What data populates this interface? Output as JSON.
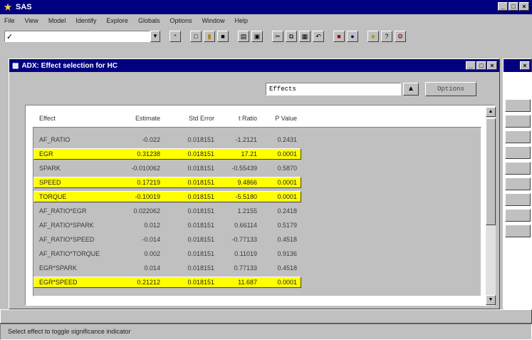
{
  "app": {
    "title": "SAS"
  },
  "menu": [
    "File",
    "View",
    "Model",
    "Identify",
    "Explore",
    "Globals",
    "Options",
    "Window",
    "Help"
  ],
  "window": {
    "title": "ADX: Effect selection for HC",
    "selector_value": "Effects",
    "options_label": "Options"
  },
  "table": {
    "headers": [
      "Effect",
      "Estimate",
      "Std Error",
      "t Ratio",
      "P Value"
    ],
    "rows": [
      {
        "effect": "AF_RATIO",
        "estimate": "-0.022",
        "std_error": "0.018151",
        "t_ratio": "-1.2121",
        "p_value": "0.2431",
        "highlighted": false
      },
      {
        "effect": "EGR",
        "estimate": "0.31238",
        "std_error": "0.018151",
        "t_ratio": "17.21",
        "p_value": "0.0001",
        "highlighted": true
      },
      {
        "effect": "SPARK",
        "estimate": "-0.010062",
        "std_error": "0.018151",
        "t_ratio": "-0.55439",
        "p_value": "0.5870",
        "highlighted": false
      },
      {
        "effect": "SPEED",
        "estimate": "0.17219",
        "std_error": "0.018151",
        "t_ratio": "9.4866",
        "p_value": "0.0001",
        "highlighted": true
      },
      {
        "effect": "TORQUE",
        "estimate": "-0.10019",
        "std_error": "0.018151",
        "t_ratio": "-5.5180",
        "p_value": "0.0001",
        "highlighted": true
      },
      {
        "effect": "AF_RATIO*EGR",
        "estimate": "0.022062",
        "std_error": "0.018151",
        "t_ratio": "1.2155",
        "p_value": "0.2418",
        "highlighted": false
      },
      {
        "effect": "AF_RATIO*SPARK",
        "estimate": "0.012",
        "std_error": "0.018151",
        "t_ratio": "0.66114",
        "p_value": "0.5179",
        "highlighted": false
      },
      {
        "effect": "AF_RATIO*SPEED",
        "estimate": "-0.014",
        "std_error": "0.018151",
        "t_ratio": "-0.77133",
        "p_value": "0.4518",
        "highlighted": false
      },
      {
        "effect": "AF_RATIO*TORQUE",
        "estimate": "0.002",
        "std_error": "0.018151",
        "t_ratio": "0.11019",
        "p_value": "0.9136",
        "highlighted": false
      },
      {
        "effect": "EGR*SPARK",
        "estimate": "0.014",
        "std_error": "0.018151",
        "t_ratio": "0.77133",
        "p_value": "0.4518",
        "highlighted": false
      },
      {
        "effect": "EGR*SPEED",
        "estimate": "0.21212",
        "std_error": "0.018151",
        "t_ratio": "11.687",
        "p_value": "0.0001",
        "highlighted": true
      }
    ]
  },
  "status": "Select effect to toggle significance indicator",
  "colors": {
    "title_bar": "#000080",
    "highlight": "#ffff00",
    "face": "#c0c0c0"
  },
  "icons": {
    "app": "sas-logo-icon",
    "selector": "dropdown-arrow-icon"
  }
}
